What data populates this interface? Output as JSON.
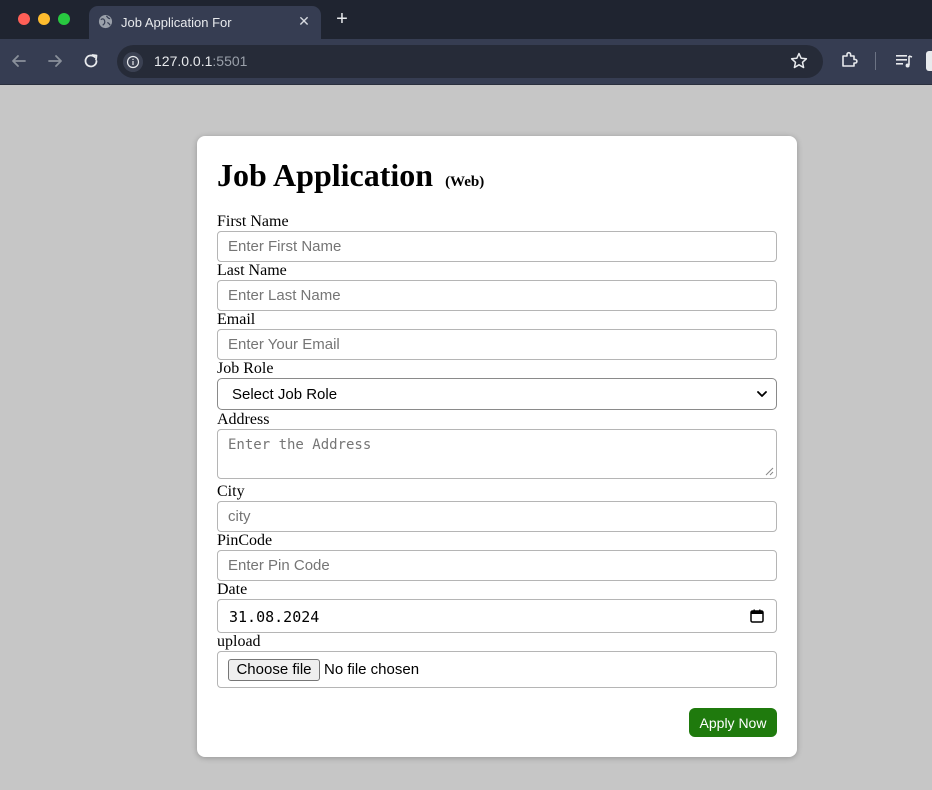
{
  "browser": {
    "tab_title": "Job Application For",
    "tab_close": "✕",
    "new_tab": "+",
    "url_host": "127.0.0.1",
    "url_port": ":5501",
    "icons": {
      "tab_favicon": "globe-icon",
      "back": "arrow-left-icon",
      "forward": "arrow-right-icon",
      "reload": "reload-icon",
      "site_info": "info-icon",
      "bookmark": "star-icon",
      "extensions": "puzzle-icon",
      "media": "media-control-icon"
    }
  },
  "form": {
    "title": "Job Application",
    "title_suffix": "(Web)",
    "first_name": {
      "label": "First Name",
      "placeholder": "Enter First Name"
    },
    "last_name": {
      "label": "Last Name",
      "placeholder": "Enter Last Name"
    },
    "email": {
      "label": "Email",
      "placeholder": "Enter Your Email"
    },
    "job_role": {
      "label": "Job Role",
      "selected": "Select Job Role"
    },
    "address": {
      "label": "Address",
      "placeholder": "Enter the Address"
    },
    "city": {
      "label": "City",
      "placeholder": "city"
    },
    "pincode": {
      "label": "PinCode",
      "placeholder": "Enter Pin Code"
    },
    "date": {
      "label": "Date",
      "value": "31.08.2024"
    },
    "upload": {
      "label": "upload",
      "button": "Choose file",
      "status": "No file chosen"
    },
    "submit_label": "Apply Now"
  },
  "colors": {
    "page_background": "#c6c6c6",
    "chrome_dark": "#1f2430",
    "chrome_toolbar": "#363d52",
    "submit_button": "#1f7a0d"
  }
}
